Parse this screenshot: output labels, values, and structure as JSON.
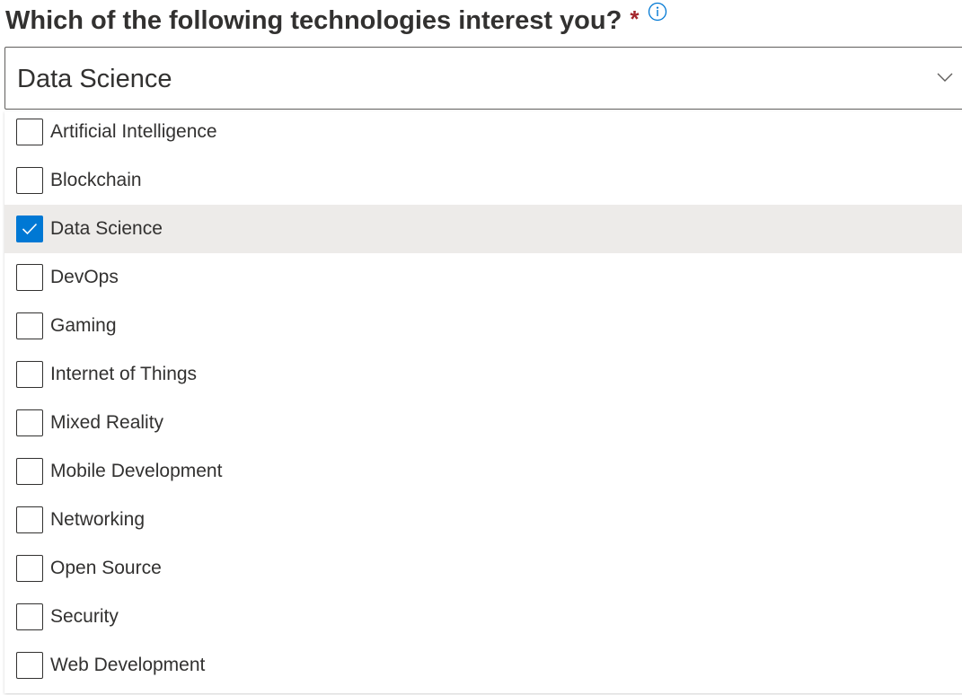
{
  "question": {
    "text": "Which of the following technologies interest you?",
    "required_marker": "*",
    "info_icon": "info-icon"
  },
  "select": {
    "value": "Data Science",
    "chevron_icon": "chevron-down-icon"
  },
  "options": [
    {
      "label": "Artificial Intelligence",
      "checked": false
    },
    {
      "label": "Blockchain",
      "checked": false
    },
    {
      "label": "Data Science",
      "checked": true
    },
    {
      "label": "DevOps",
      "checked": false
    },
    {
      "label": "Gaming",
      "checked": false
    },
    {
      "label": "Internet of Things",
      "checked": false
    },
    {
      "label": "Mixed Reality",
      "checked": false
    },
    {
      "label": "Mobile Development",
      "checked": false
    },
    {
      "label": "Networking",
      "checked": false
    },
    {
      "label": "Open Source",
      "checked": false
    },
    {
      "label": "Security",
      "checked": false
    },
    {
      "label": "Web Development",
      "checked": false
    }
  ],
  "colors": {
    "accent": "#0078d4",
    "required": "#a4262c",
    "selected_row": "#edebe9",
    "text": "#323130"
  }
}
